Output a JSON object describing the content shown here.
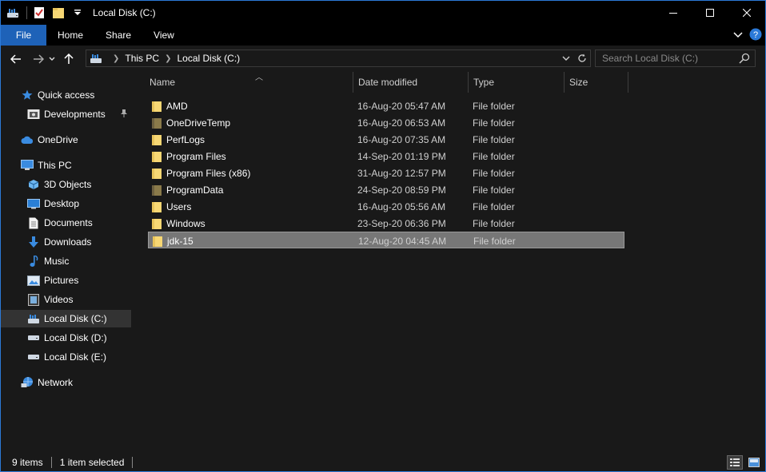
{
  "window": {
    "title": "Local Disk (C:)"
  },
  "ribbon": {
    "tabs": [
      {
        "label": "File"
      },
      {
        "label": "Home"
      },
      {
        "label": "Share"
      },
      {
        "label": "View"
      }
    ]
  },
  "address": {
    "crumbs": [
      "This PC",
      "Local Disk (C:)"
    ]
  },
  "search": {
    "placeholder": "Search Local Disk (C:)"
  },
  "sidebar": {
    "items": [
      {
        "label": "Quick access",
        "icon": "star-icon"
      },
      {
        "label": "Developments",
        "icon": "folder-icon"
      },
      {
        "label": "OneDrive",
        "icon": "cloud-icon"
      },
      {
        "label": "This PC",
        "icon": "computer-icon"
      },
      {
        "label": "3D Objects",
        "icon": "cube-icon"
      },
      {
        "label": "Desktop",
        "icon": "desktop-icon"
      },
      {
        "label": "Documents",
        "icon": "document-icon"
      },
      {
        "label": "Downloads",
        "icon": "download-icon"
      },
      {
        "label": "Music",
        "icon": "music-icon"
      },
      {
        "label": "Pictures",
        "icon": "picture-icon"
      },
      {
        "label": "Videos",
        "icon": "video-icon"
      },
      {
        "label": "Local Disk (C:)",
        "icon": "drive-icon",
        "selected": true
      },
      {
        "label": "Local Disk (D:)",
        "icon": "drive-icon"
      },
      {
        "label": "Local Disk (E:)",
        "icon": "drive-icon"
      },
      {
        "label": "Network",
        "icon": "network-icon"
      }
    ]
  },
  "columns": [
    "Name",
    "Date modified",
    "Type",
    "Size"
  ],
  "files": [
    {
      "name": "AMD",
      "date": "16-Aug-20 05:47 AM",
      "type": "File folder",
      "hidden": false
    },
    {
      "name": "OneDriveTemp",
      "date": "16-Aug-20 06:53 AM",
      "type": "File folder",
      "hidden": true
    },
    {
      "name": "PerfLogs",
      "date": "16-Aug-20 07:35 AM",
      "type": "File folder",
      "hidden": false
    },
    {
      "name": "Program Files",
      "date": "14-Sep-20 01:19 PM",
      "type": "File folder",
      "hidden": false
    },
    {
      "name": "Program Files (x86)",
      "date": "31-Aug-20 12:57 PM",
      "type": "File folder",
      "hidden": false
    },
    {
      "name": "ProgramData",
      "date": "24-Sep-20 08:59 PM",
      "type": "File folder",
      "hidden": true
    },
    {
      "name": "Users",
      "date": "16-Aug-20 05:56 AM",
      "type": "File folder",
      "hidden": false
    },
    {
      "name": "Windows",
      "date": "23-Sep-20 06:36 PM",
      "type": "File folder",
      "hidden": false
    },
    {
      "name": "jdk-15",
      "date": "12-Aug-20 04:45 AM",
      "type": "File folder",
      "hidden": false,
      "selected": true
    }
  ],
  "status": {
    "item_count": "9 items",
    "selection": "1 item selected"
  },
  "colors": {
    "accent": "#1e62b8",
    "folder": "#f7d774",
    "folder_hidden": "#8a7a4a",
    "selected_row": "#777777"
  }
}
